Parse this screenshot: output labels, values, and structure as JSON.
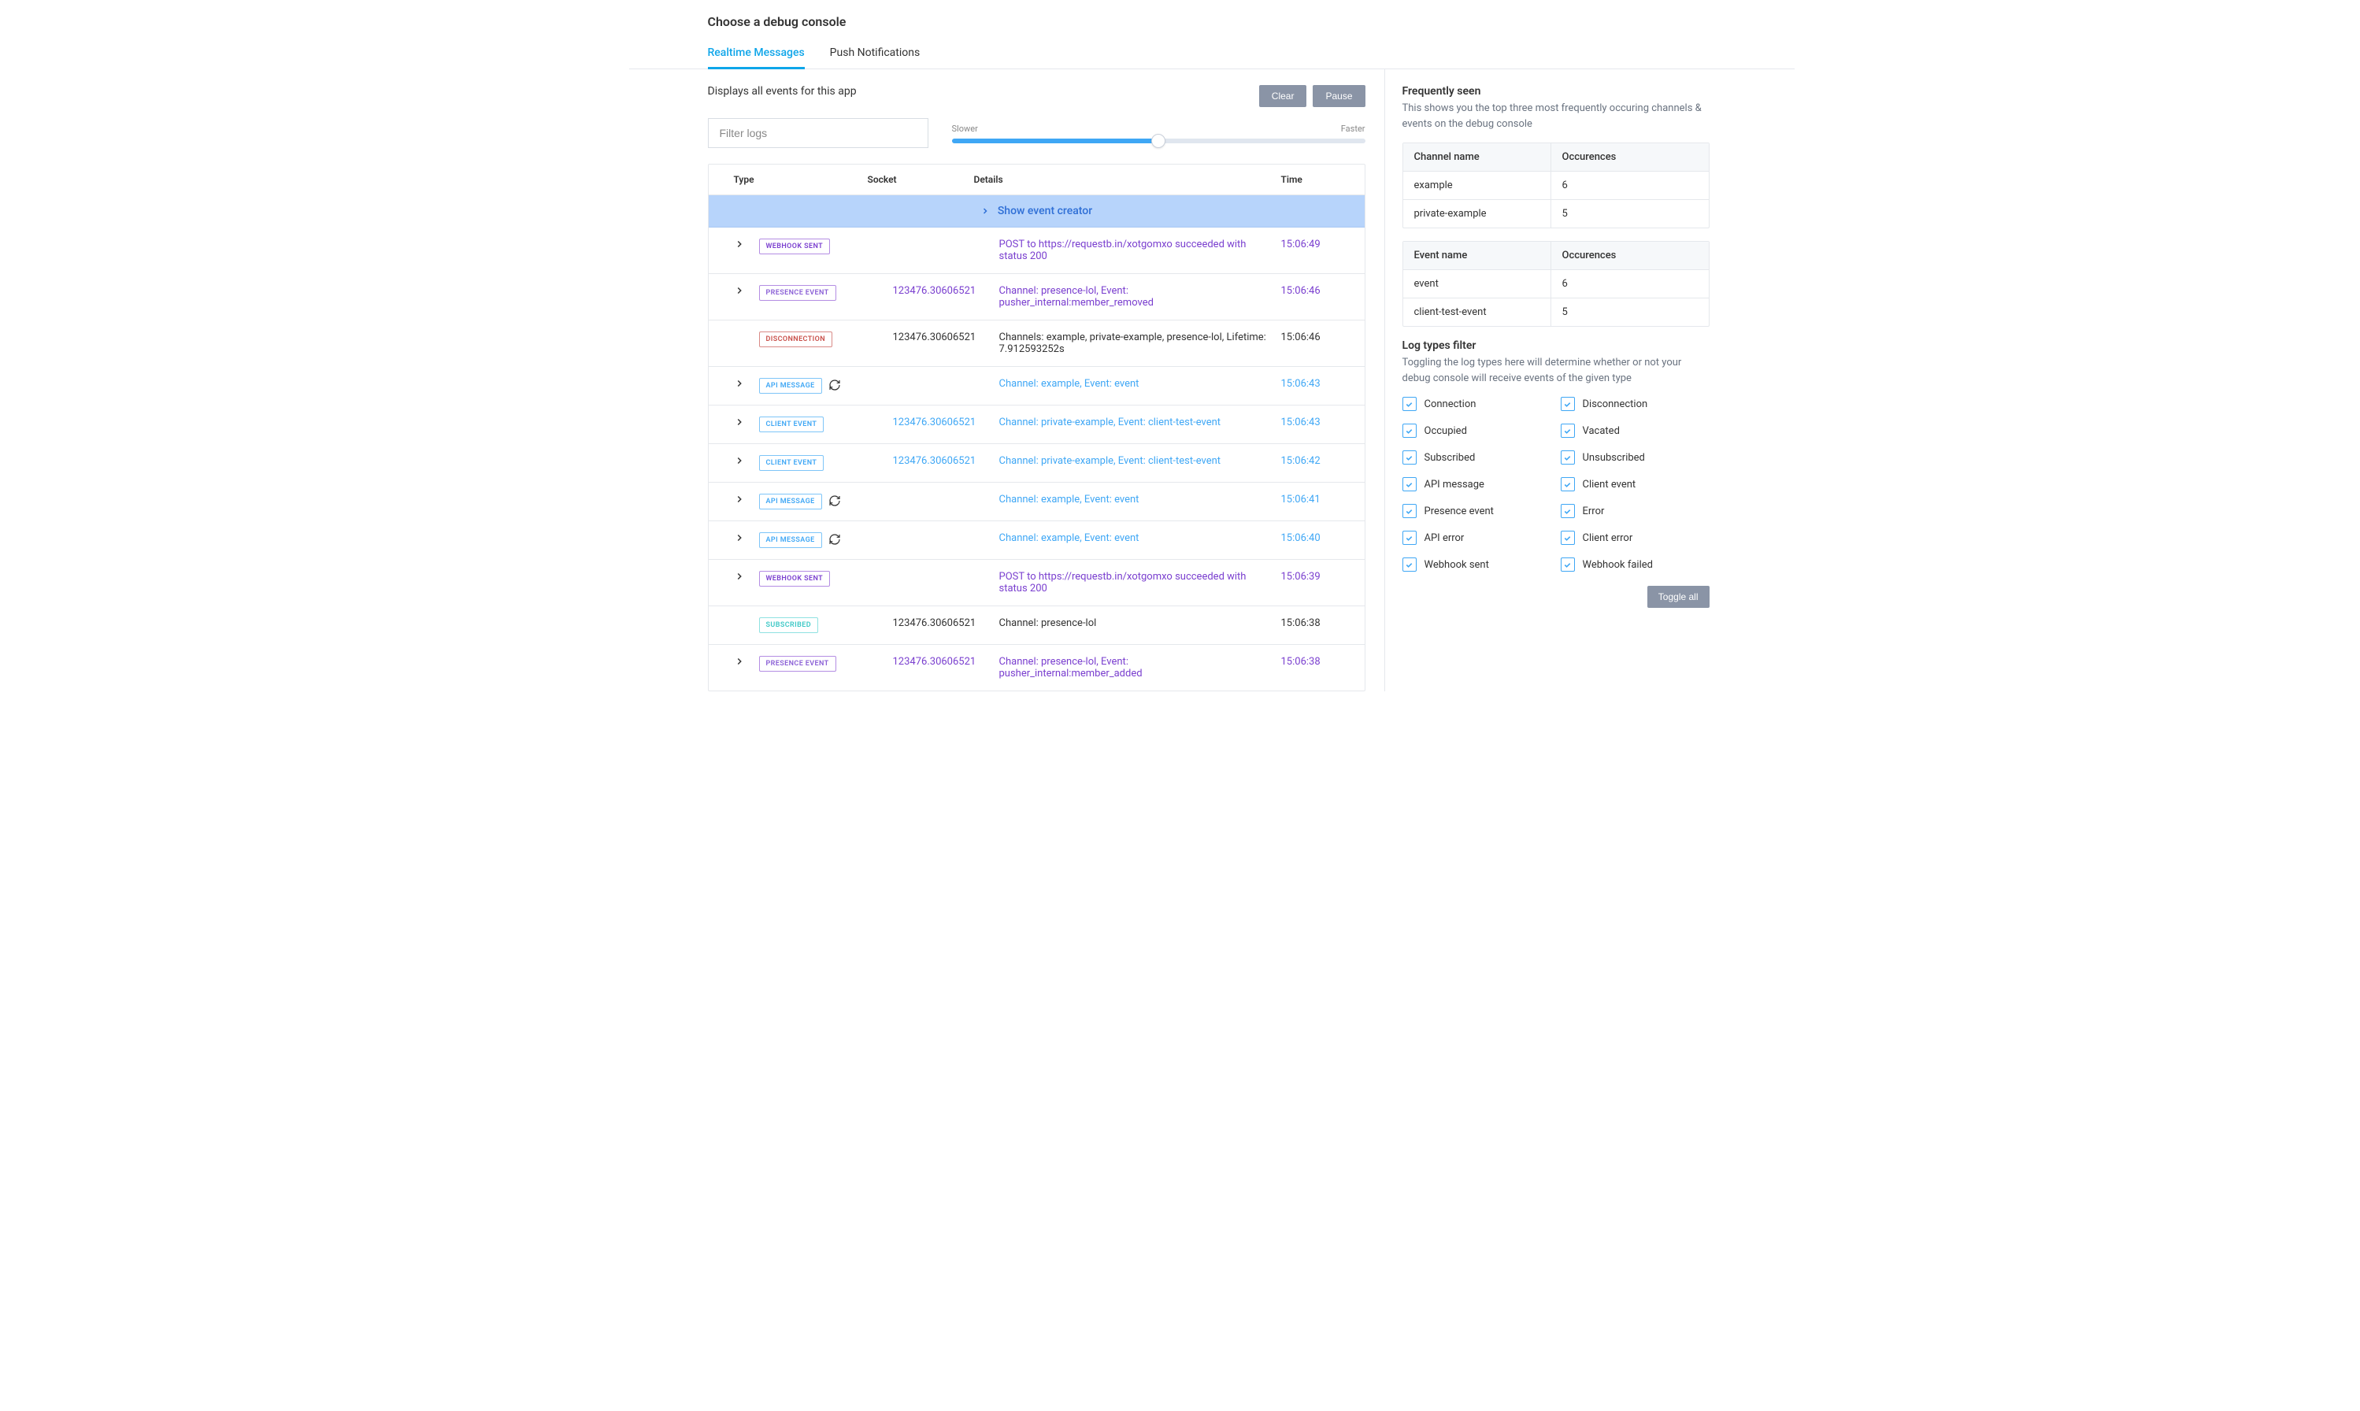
{
  "header": {
    "title": "Choose a debug console",
    "tabs": [
      {
        "label": "Realtime Messages",
        "active": true
      },
      {
        "label": "Push Notifications",
        "active": false
      }
    ]
  },
  "main": {
    "description": "Displays all events for this app",
    "buttons": {
      "clear": "Clear",
      "pause": "Pause"
    },
    "filter_placeholder": "Filter logs",
    "slider": {
      "slow_label": "Slower",
      "fast_label": "Faster"
    },
    "columns": {
      "type": "Type",
      "socket": "Socket",
      "details": "Details",
      "time": "Time"
    },
    "creator_label": "Show event creator",
    "rows": [
      {
        "expandable": true,
        "badge": "WEBHOOK SENT",
        "badge_class": "webhook",
        "refresh": false,
        "socket": "",
        "details": "POST to https://requestb.in/xotgomxo succeeded with status 200",
        "details_color": "purple",
        "time": "15:06:49"
      },
      {
        "expandable": true,
        "badge": "PRESENCE EVENT",
        "badge_class": "presence",
        "refresh": false,
        "socket": "123476.30606521",
        "details": "Channel: presence-lol, Event: pusher_internal:member_removed",
        "details_color": "purple",
        "time": "15:06:46"
      },
      {
        "expandable": false,
        "badge": "DISCONNECTION",
        "badge_class": "disconnection",
        "refresh": false,
        "socket": "123476.30606521",
        "details": "Channels: example, private-example, presence-lol, Lifetime: 7.912593252s",
        "details_color": "plain",
        "time": "15:06:46"
      },
      {
        "expandable": true,
        "badge": "API MESSAGE",
        "badge_class": "api",
        "refresh": true,
        "socket": "",
        "details": "Channel: example, Event: event",
        "details_color": "blue",
        "time": "15:06:43"
      },
      {
        "expandable": true,
        "badge": "CLIENT EVENT",
        "badge_class": "client",
        "refresh": false,
        "socket": "123476.30606521",
        "details": "Channel: private-example, Event: client-test-event",
        "details_color": "blue",
        "time": "15:06:43"
      },
      {
        "expandable": true,
        "badge": "CLIENT EVENT",
        "badge_class": "client",
        "refresh": false,
        "socket": "123476.30606521",
        "details": "Channel: private-example, Event: client-test-event",
        "details_color": "blue",
        "time": "15:06:42"
      },
      {
        "expandable": true,
        "badge": "API MESSAGE",
        "badge_class": "api",
        "refresh": true,
        "socket": "",
        "details": "Channel: example, Event: event",
        "details_color": "blue",
        "time": "15:06:41"
      },
      {
        "expandable": true,
        "badge": "API MESSAGE",
        "badge_class": "api",
        "refresh": true,
        "socket": "",
        "details": "Channel: example, Event: event",
        "details_color": "blue",
        "time": "15:06:40"
      },
      {
        "expandable": true,
        "badge": "WEBHOOK SENT",
        "badge_class": "webhook",
        "refresh": false,
        "socket": "",
        "details": "POST to https://requestb.in/xotgomxo succeeded with status 200",
        "details_color": "purple",
        "time": "15:06:39"
      },
      {
        "expandable": false,
        "badge": "SUBSCRIBED",
        "badge_class": "subscribed",
        "refresh": false,
        "socket": "123476.30606521",
        "details": "Channel: presence-lol",
        "details_color": "plain",
        "time": "15:06:38"
      },
      {
        "expandable": true,
        "badge": "PRESENCE EVENT",
        "badge_class": "presence",
        "refresh": false,
        "socket": "123476.30606521",
        "details": "Channel: presence-lol, Event: pusher_internal:member_added",
        "details_color": "purple",
        "time": "15:06:38"
      }
    ]
  },
  "side": {
    "freq_title": "Frequently seen",
    "freq_sub": "This shows you the top three most frequently occuring channels & events on the debug console",
    "channel_table": {
      "head1": "Channel name",
      "head2": "Occurences",
      "rows": [
        {
          "name": "example",
          "count": "6"
        },
        {
          "name": "private-example",
          "count": "5"
        }
      ]
    },
    "event_table": {
      "head1": "Event name",
      "head2": "Occurences",
      "rows": [
        {
          "name": "event",
          "count": "6"
        },
        {
          "name": "client-test-event",
          "count": "5"
        }
      ]
    },
    "filter_title": "Log types filter",
    "filter_sub": "Toggling the log types here will determine whether or not your debug console will receive events of the given type",
    "checks": [
      "Connection",
      "Disconnection",
      "Occupied",
      "Vacated",
      "Subscribed",
      "Unsubscribed",
      "API message",
      "Client event",
      "Presence event",
      "Error",
      "API error",
      "Client error",
      "Webhook sent",
      "Webhook failed"
    ],
    "toggle_all": "Toggle all"
  }
}
